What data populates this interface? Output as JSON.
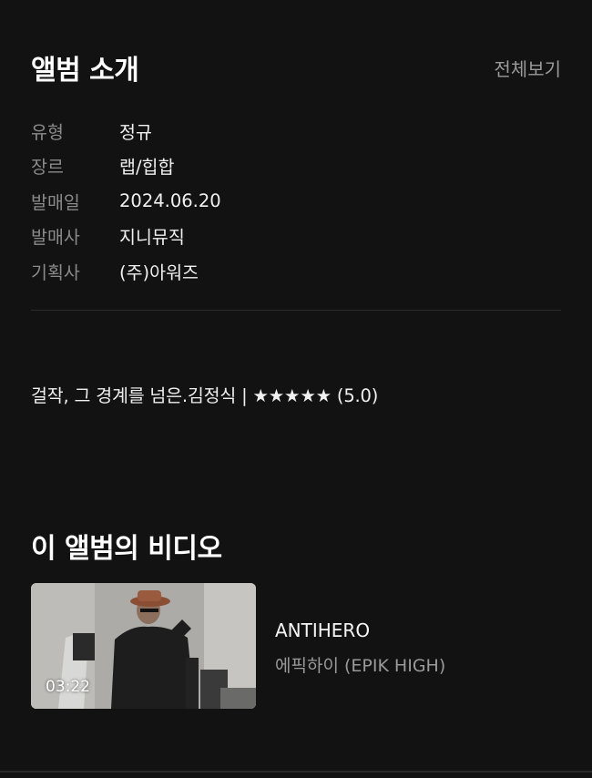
{
  "album_intro": {
    "title": "앨범 소개",
    "see_all_label": "전체보기",
    "info": [
      {
        "label": "유형",
        "value": "정규"
      },
      {
        "label": "장르",
        "value": "랩/힙합"
      },
      {
        "label": "발매일",
        "value": "2024.06.20"
      },
      {
        "label": "발매사",
        "value": "지니뮤직"
      },
      {
        "label": "기획사",
        "value": "(주)아워즈"
      }
    ],
    "review": "걸작, 그 경계를 넘은.김정식 | ★★★★★ (5.0)"
  },
  "videos": {
    "title": "이 앨범의 비디오",
    "items": [
      {
        "title": "ANTIHERO",
        "artist": "에픽하이 (EPIK HIGH)",
        "duration": "03:22"
      }
    ]
  },
  "colors": {
    "background": "#121212",
    "text_primary": "#ffffff",
    "text_secondary": "#8a8a8a"
  }
}
